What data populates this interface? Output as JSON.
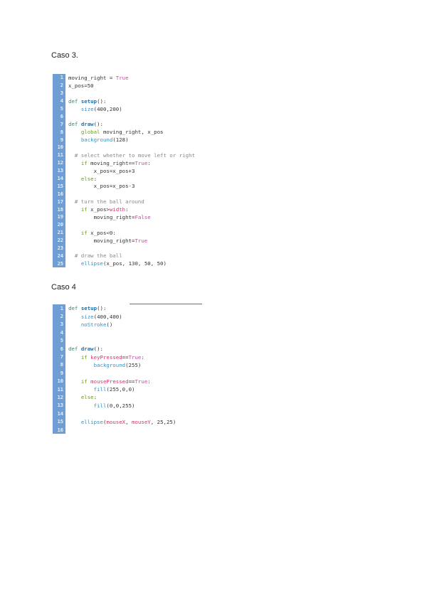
{
  "headings": {
    "case3": "Caso 3.",
    "case4": "Caso 4"
  },
  "code_blocks": [
    {
      "lines": [
        [
          [
            "moving_right = ",
            ""
          ],
          [
            "True",
            "lit"
          ]
        ],
        [
          [
            "x_pos=50",
            ""
          ]
        ],
        [],
        [
          [
            "def ",
            "kw"
          ],
          [
            "setup",
            "fn"
          ],
          [
            "():",
            ""
          ]
        ],
        [
          [
            "    ",
            ""
          ],
          [
            "size",
            "bi"
          ],
          [
            "(400,200)",
            ""
          ]
        ],
        [],
        [
          [
            "def ",
            "kw"
          ],
          [
            "draw",
            "fn"
          ],
          [
            "():",
            ""
          ]
        ],
        [
          [
            "    ",
            ""
          ],
          [
            "global ",
            "el"
          ],
          [
            "moving_right, x_pos",
            ""
          ]
        ],
        [
          [
            "    ",
            ""
          ],
          [
            "background",
            "bi"
          ],
          [
            "(128)",
            ""
          ]
        ],
        [],
        [
          [
            "  # select whether to move left or right",
            "cm"
          ]
        ],
        [
          [
            "    ",
            ""
          ],
          [
            "if ",
            "el"
          ],
          [
            "moving_right==",
            ""
          ],
          [
            "True",
            "lit"
          ],
          [
            ":",
            ""
          ]
        ],
        [
          [
            "        x_pos=x_pos+3",
            ""
          ]
        ],
        [
          [
            "    ",
            ""
          ],
          [
            "else",
            "el"
          ],
          [
            ":",
            ""
          ]
        ],
        [
          [
            "        x_pos=x_pos-3",
            ""
          ]
        ],
        [],
        [
          [
            "  # turn the ball around",
            "cm"
          ]
        ],
        [
          [
            "    ",
            ""
          ],
          [
            "if ",
            "el"
          ],
          [
            "x_pos>",
            ""
          ],
          [
            "width",
            "var"
          ],
          [
            ":",
            ""
          ]
        ],
        [
          [
            "        moving_right=",
            ""
          ],
          [
            "False",
            "lit"
          ]
        ],
        [],
        [
          [
            "    ",
            ""
          ],
          [
            "if ",
            "el"
          ],
          [
            "x_pos<0:",
            ""
          ]
        ],
        [
          [
            "        moving_right=",
            ""
          ],
          [
            "True",
            "lit"
          ]
        ],
        [],
        [
          [
            "  # draw the ball",
            "cm"
          ]
        ],
        [
          [
            "    ",
            ""
          ],
          [
            "ellipse",
            "bi"
          ],
          [
            "(x_pos, 130, 50, 50)",
            ""
          ]
        ]
      ]
    },
    {
      "lines": [
        [
          [
            "def ",
            "kw"
          ],
          [
            "setup",
            "fn"
          ],
          [
            "():",
            ""
          ]
        ],
        [
          [
            "    ",
            ""
          ],
          [
            "size",
            "bi"
          ],
          [
            "(400,400)",
            ""
          ]
        ],
        [
          [
            "    ",
            ""
          ],
          [
            "noStroke",
            "bi"
          ],
          [
            "()",
            ""
          ]
        ],
        [],
        [],
        [
          [
            "def ",
            "kw"
          ],
          [
            "draw",
            "fn"
          ],
          [
            "():",
            ""
          ]
        ],
        [
          [
            "    ",
            ""
          ],
          [
            "if ",
            "el"
          ],
          [
            "keyPressed",
            "var"
          ],
          [
            "==",
            ""
          ],
          [
            "True",
            "lit"
          ],
          [
            ":",
            ""
          ]
        ],
        [
          [
            "        ",
            ""
          ],
          [
            "background",
            "bi"
          ],
          [
            "(255)",
            ""
          ]
        ],
        [],
        [
          [
            "    ",
            ""
          ],
          [
            "if ",
            "el"
          ],
          [
            "mousePressed",
            "var"
          ],
          [
            "==",
            ""
          ],
          [
            "True",
            "lit"
          ],
          [
            ":",
            ""
          ]
        ],
        [
          [
            "        ",
            ""
          ],
          [
            "fill",
            "bi"
          ],
          [
            "(255,0,0)",
            ""
          ]
        ],
        [
          [
            "    ",
            ""
          ],
          [
            "else",
            "el"
          ],
          [
            ":",
            ""
          ]
        ],
        [
          [
            "        ",
            ""
          ],
          [
            "fill",
            "bi"
          ],
          [
            "(0,0,255)",
            ""
          ]
        ],
        [],
        [
          [
            "    ",
            ""
          ],
          [
            "ellipse",
            "bi"
          ],
          [
            "(",
            ""
          ],
          [
            "mouseX",
            "var"
          ],
          [
            ", ",
            ""
          ],
          [
            "mouseY",
            "var"
          ],
          [
            ", 25,25)",
            ""
          ]
        ],
        []
      ]
    }
  ]
}
